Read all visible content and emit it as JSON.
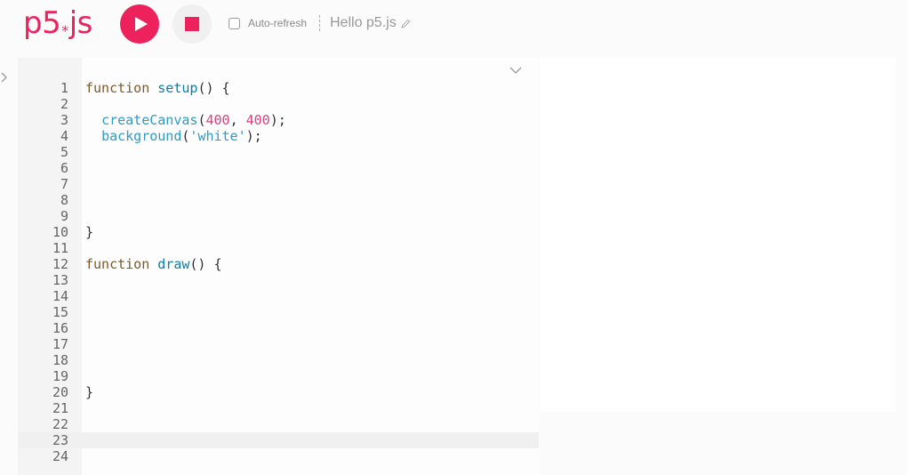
{
  "app": {
    "logo": {
      "main": "p5",
      "asterisk": "*",
      "suffix": "js"
    },
    "auto_refresh_label": "Auto-refresh",
    "sketch_name": "Hello p5.js"
  },
  "colors": {
    "accent": "#ed225d",
    "keyword": "#7a5a2a",
    "function_name": "#0b7ca9",
    "p5_function": "#2e9bc2",
    "number": "#d4437f",
    "string": "#2e9bc2"
  },
  "icons": {
    "play": "play-icon",
    "stop": "stop-icon",
    "pencil": "pencil-icon",
    "sidebar": "chevron-right-icon",
    "collapse": "chevron-down-icon"
  },
  "editor": {
    "active_line": 23,
    "lines": [
      {
        "n": "1",
        "tokens": [
          {
            "t": "function",
            "c": "kw"
          },
          {
            "t": " ",
            "c": "pun"
          },
          {
            "t": "setup",
            "c": "fn"
          },
          {
            "t": "() {",
            "c": "pun"
          }
        ]
      },
      {
        "n": "2",
        "tokens": []
      },
      {
        "n": "3",
        "tokens": [
          {
            "t": "  ",
            "c": "pun"
          },
          {
            "t": "createCanvas",
            "c": "cv"
          },
          {
            "t": "(",
            "c": "pun"
          },
          {
            "t": "400",
            "c": "num"
          },
          {
            "t": ", ",
            "c": "pun"
          },
          {
            "t": "400",
            "c": "num"
          },
          {
            "t": ");",
            "c": "pun"
          }
        ]
      },
      {
        "n": "4",
        "tokens": [
          {
            "t": "  ",
            "c": "pun"
          },
          {
            "t": "background",
            "c": "cv"
          },
          {
            "t": "(",
            "c": "pun"
          },
          {
            "t": "'white'",
            "c": "str"
          },
          {
            "t": ");",
            "c": "pun"
          }
        ]
      },
      {
        "n": "5",
        "tokens": []
      },
      {
        "n": "6",
        "tokens": []
      },
      {
        "n": "7",
        "tokens": []
      },
      {
        "n": "8",
        "tokens": []
      },
      {
        "n": "9",
        "tokens": []
      },
      {
        "n": "10",
        "tokens": [
          {
            "t": "}",
            "c": "pun"
          }
        ]
      },
      {
        "n": "11",
        "tokens": []
      },
      {
        "n": "12",
        "tokens": [
          {
            "t": "function",
            "c": "kw"
          },
          {
            "t": " ",
            "c": "pun"
          },
          {
            "t": "draw",
            "c": "fn"
          },
          {
            "t": "() {",
            "c": "pun"
          }
        ]
      },
      {
        "n": "13",
        "tokens": []
      },
      {
        "n": "14",
        "tokens": []
      },
      {
        "n": "15",
        "tokens": []
      },
      {
        "n": "16",
        "tokens": []
      },
      {
        "n": "17",
        "tokens": []
      },
      {
        "n": "18",
        "tokens": []
      },
      {
        "n": "19",
        "tokens": []
      },
      {
        "n": "20",
        "tokens": [
          {
            "t": "}",
            "c": "pun"
          }
        ]
      },
      {
        "n": "21",
        "tokens": []
      },
      {
        "n": "22",
        "tokens": []
      },
      {
        "n": "23",
        "tokens": []
      },
      {
        "n": "24",
        "tokens": []
      }
    ]
  }
}
